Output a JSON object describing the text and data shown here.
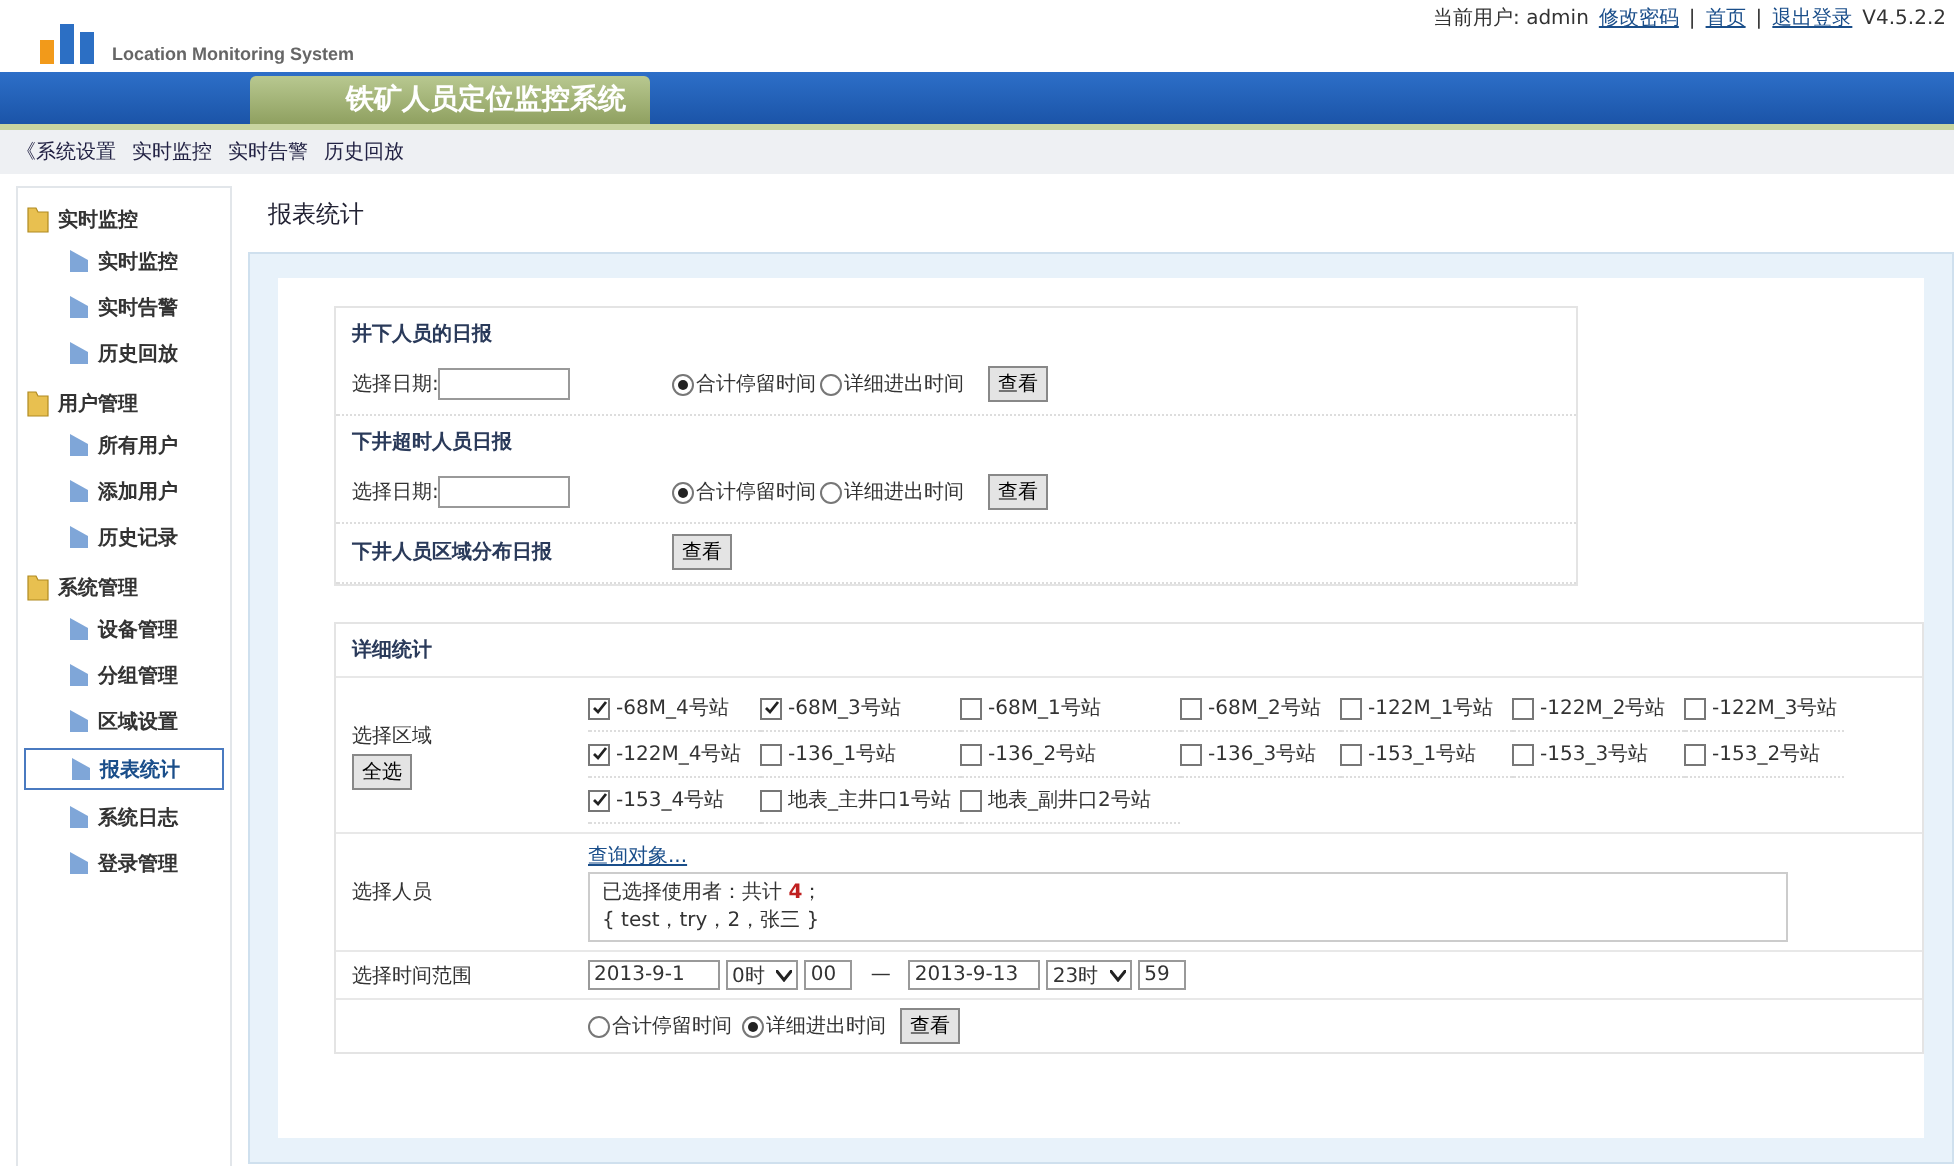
{
  "header": {
    "app_name": "Location Monitoring System",
    "current_user": "当前用户: admin",
    "links": [
      "修改密码",
      "首页",
      "退出登录"
    ],
    "separator": "|",
    "version": "V4.5.2.2"
  },
  "banner": {
    "title": "铁矿人员定位监控系统"
  },
  "nav": {
    "items": [
      "《系统设置",
      "实时监控",
      "实时告警",
      "历史回放"
    ]
  },
  "sidebar": {
    "groups": [
      {
        "label": "实时监控",
        "children": [
          {
            "label": "实时监控",
            "selected": false
          },
          {
            "label": "实时告警",
            "selected": false
          },
          {
            "label": "历史回放",
            "selected": false
          }
        ]
      },
      {
        "label": "用户管理",
        "children": [
          {
            "label": "所有用户",
            "selected": false
          },
          {
            "label": "添加用户",
            "selected": false
          },
          {
            "label": "历史记录",
            "selected": false
          }
        ]
      },
      {
        "label": "系统管理",
        "children": [
          {
            "label": "设备管理",
            "selected": false
          },
          {
            "label": "分组管理",
            "selected": false
          },
          {
            "label": "区域设置",
            "selected": false
          },
          {
            "label": "报表统计",
            "selected": true
          },
          {
            "label": "系统日志",
            "selected": false
          },
          {
            "label": "登录管理",
            "selected": false
          }
        ]
      }
    ]
  },
  "page_title": "报表统计",
  "daily_reports": [
    {
      "kind": "date",
      "title": "井下人员的日报",
      "date_label": "选择日期:",
      "options": [
        {
          "label": "合计停留时间",
          "selected": true
        },
        {
          "label": "详细进出时间",
          "selected": false
        }
      ],
      "button": "查看"
    },
    {
      "kind": "date",
      "title": "下井超时人员日报",
      "date_label": "选择日期:",
      "options": [
        {
          "label": "合计停留时间",
          "selected": true
        },
        {
          "label": "详细进出时间",
          "selected": false
        }
      ],
      "button": "查看"
    },
    {
      "kind": "simple",
      "title": "下井人员区域分布日报",
      "button": "查看"
    }
  ],
  "detail": {
    "title": "详细统计",
    "area_label": "选择区域",
    "select_all": "全选",
    "stations": [
      [
        {
          "label": "-68M_4号站",
          "checked": true
        },
        {
          "label": "-68M_3号站",
          "checked": true
        },
        {
          "label": "-68M_1号站",
          "checked": false
        },
        {
          "label": "-68M_2号站",
          "checked": false
        },
        {
          "label": "-122M_1号站",
          "checked": false
        },
        {
          "label": "-122M_2号站",
          "checked": false
        },
        {
          "label": "-122M_3号站",
          "checked": false
        }
      ],
      [
        {
          "label": "-122M_4号站",
          "checked": true
        },
        {
          "label": "-136_1号站",
          "checked": false
        },
        {
          "label": "-136_2号站",
          "checked": false
        },
        {
          "label": "-136_3号站",
          "checked": false
        },
        {
          "label": "-153_1号站",
          "checked": false
        },
        {
          "label": "-153_3号站",
          "checked": false
        },
        {
          "label": "-153_2号站",
          "checked": false
        }
      ],
      [
        {
          "label": "-153_4号站",
          "checked": true
        },
        {
          "label": "地表_主井口1号站",
          "checked": false
        },
        {
          "label": "地表_副井口2号站",
          "checked": false
        }
      ]
    ],
    "person_label": "选择人员",
    "query_link": "查询对象...",
    "selected_summary": "已选择使用者：共计 **4**；",
    "selected_list": "{ test，try，2，张三 }",
    "time_label": "选择时间范围",
    "start_date": "2013-9-1",
    "start_hour": "0时",
    "start_min": "00",
    "dash": "—",
    "end_date": "2013-9-13",
    "end_hour": "23时",
    "end_min": "59",
    "options": [
      {
        "label": "合计停留时间",
        "selected": false
      },
      {
        "label": "详细进出时间",
        "selected": true
      }
    ],
    "button": "查看"
  }
}
